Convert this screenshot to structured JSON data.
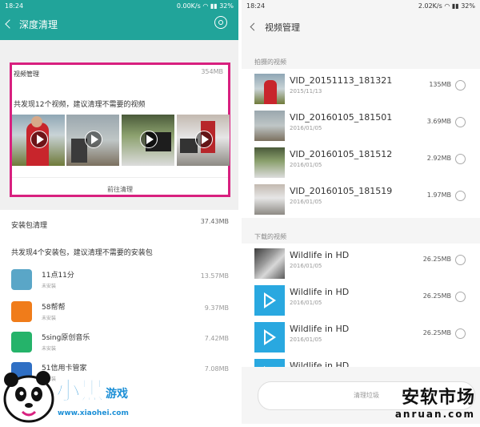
{
  "left": {
    "status": {
      "time": "18:24",
      "net": "0.00K/s",
      "battery": "32%"
    },
    "title": "深度清理",
    "video_card": {
      "heading": "视频管理",
      "size": "354MB",
      "description": "共发现12个视频，建议清理不需要的视频",
      "action": "前往清理",
      "thumb_count": 4
    },
    "package_section": {
      "heading": "安装包清理",
      "size": "37.43MB",
      "description": "共发现4个安装包，建议清理不需要的安装包",
      "apps": [
        {
          "name": "11点11分",
          "status": "未安装",
          "size": "13.57MB",
          "icon": "owl-icon",
          "color": "#5aa6c7"
        },
        {
          "name": "58帮帮",
          "status": "未安装",
          "size": "9.37MB",
          "icon": "58-icon",
          "color": "#f07c1a"
        },
        {
          "name": "5sing原创音乐",
          "status": "未安装",
          "size": "7.42MB",
          "icon": "music-icon",
          "color": "#25b36a"
        },
        {
          "name": "51信用卡管家",
          "status": "未安装",
          "size": "7.08MB",
          "icon": "card-icon",
          "color": "#2f6fc4"
        }
      ]
    },
    "accent_color": "#21a49a",
    "highlight_color": "#d8207f"
  },
  "right": {
    "status": {
      "time": "18:24",
      "net": "2.02K/s",
      "battery": "32%"
    },
    "title": "视频管理",
    "shot_section": "拍摄的视频",
    "shot_videos": [
      {
        "name": "VID_20151113_181321",
        "date": "2015/11/13",
        "size": "135MB"
      },
      {
        "name": "VID_20160105_181501",
        "date": "2016/01/05",
        "size": "3.69MB"
      },
      {
        "name": "VID_20160105_181512",
        "date": "2016/01/05",
        "size": "2.92MB"
      },
      {
        "name": "VID_20160105_181519",
        "date": "2016/01/05",
        "size": "1.97MB"
      }
    ],
    "download_section": "下载的视频",
    "download_videos": [
      {
        "name": "Wildlife in HD",
        "date": "2016/01/05",
        "size": "26.25MB"
      },
      {
        "name": "Wildlife in HD",
        "date": "2016/01/05",
        "size": "26.25MB"
      },
      {
        "name": "Wildlife in HD",
        "date": "2016/01/05",
        "size": "26.25MB"
      },
      {
        "name": "Wildlife in HD",
        "date": "",
        "size": ""
      }
    ],
    "clean_button": "清理垃圾"
  },
  "watermarks": {
    "left_cn": "小黑游戏",
    "left_url": "www.xiaohei.com",
    "right_cn": "安软市场",
    "right_en": "anruan.com"
  }
}
